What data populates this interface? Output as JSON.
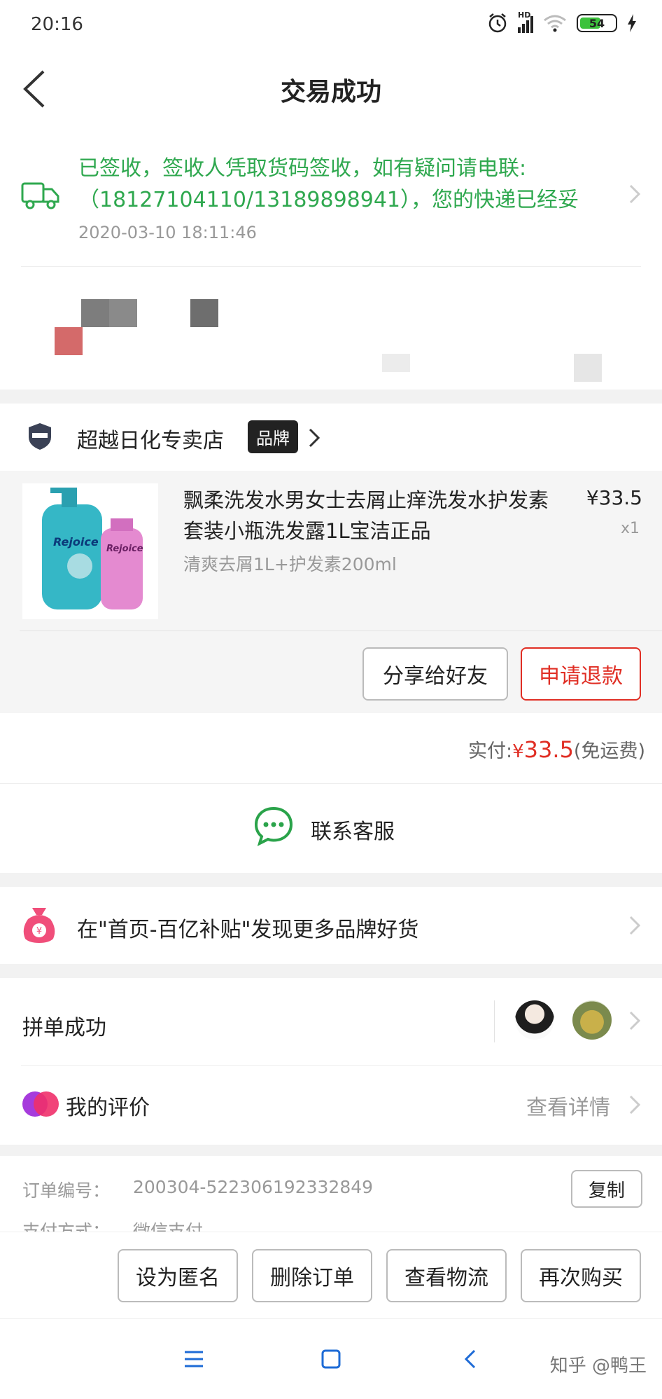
{
  "status_bar": {
    "time": "20:16",
    "battery": "54",
    "network": "HD"
  },
  "header": {
    "title": "交易成功"
  },
  "logistics": {
    "message": "已签收，签收人凭取货码签收，如有疑问请电联:（18127104110/13189898941），您的快递已经妥",
    "date": "2020-03-10 18:11:46"
  },
  "store": {
    "name": "超越日化专卖店",
    "tag": "品牌"
  },
  "product": {
    "title": "飘柔洗发水男女士去屑止痒洗发水护发素套装小瓶洗发露1L宝洁正品",
    "spec": "清爽去屑1L+护发素200ml",
    "price": "¥33.5",
    "quantity": "x1",
    "image_label_1": "Rejoice",
    "image_label_2": "Rejoice"
  },
  "product_actions": {
    "share": "分享给好友",
    "refund": "申请退款"
  },
  "payment": {
    "label": "实付:",
    "currency": "¥",
    "amount": "33.5",
    "note": "(免运费)"
  },
  "service": {
    "label": "联系客服"
  },
  "subsidy": {
    "text": "在\"首页-百亿补贴\"发现更多品牌好货"
  },
  "group_buy": {
    "label": "拼单成功"
  },
  "review": {
    "label": "我的评价",
    "link": "查看详情"
  },
  "order_info": {
    "order_no_label": "订单编号：",
    "order_no": "200304-522306192332849",
    "copy": "复制",
    "pay_method_label": "支付方式：",
    "pay_method": "微信支付"
  },
  "bottom_actions": [
    "设为匿名",
    "删除订单",
    "查看物流",
    "再次购买"
  ],
  "watermark": "知乎 @鸭王",
  "colors": {
    "accent_red": "#e02e24",
    "logistics_green": "#2fa84f",
    "chat_green": "#2aa34a"
  }
}
